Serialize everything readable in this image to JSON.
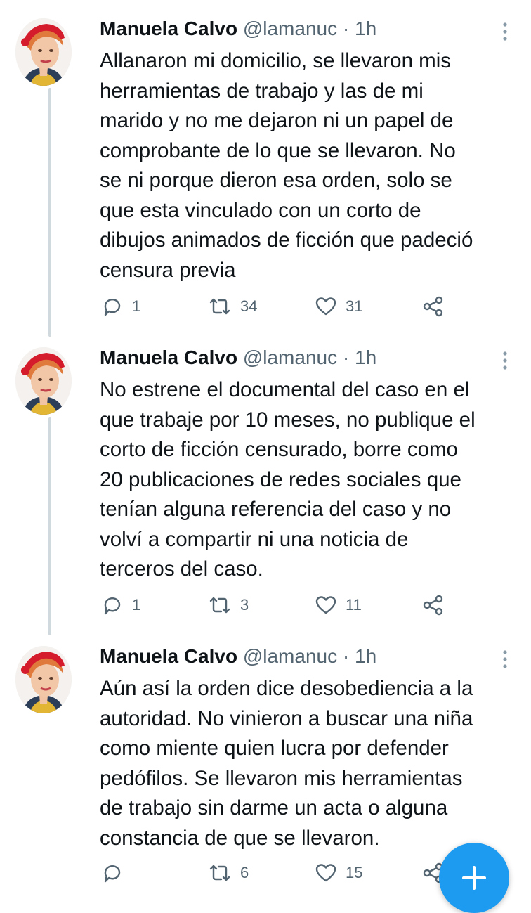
{
  "tweets": [
    {
      "name": "Manuela Calvo",
      "handle": "@lamanuc",
      "separator": "·",
      "time": "1h",
      "lines": [
        "Allanaron mi domicilio, se llevaron mis",
        "herramientas de trabajo y las de mi",
        "marido y no me dejaron ni un papel de",
        "comprobante de lo que se llevaron. No",
        "se ni porque dieron esa orden, solo se",
        "que esta vinculado con un corto de",
        "dibujos animados de ficción que padeció",
        "censura previa"
      ],
      "replies": "1",
      "retweets": "34",
      "likes": "31"
    },
    {
      "name": "Manuela Calvo",
      "handle": "@lamanuc",
      "separator": "·",
      "time": "1h",
      "lines": [
        "No estrene el documental del caso en el",
        "que trabaje por 10 meses, no publique el",
        "corto de ficción censurado, borre como",
        "20 publicaciones de redes sociales que",
        "tenían alguna referencia del caso y no",
        "volví a compartir ni una noticia de",
        "terceros del caso."
      ],
      "replies": "1",
      "retweets": "3",
      "likes": "11"
    },
    {
      "name": "Manuela Calvo",
      "handle": "@lamanuc",
      "separator": "·",
      "time": "1h",
      "lines": [
        "Aún así la orden dice desobediencia a la",
        "autoridad. No vinieron a buscar una niña",
        "como miente quien lucra por defender",
        "pedófilos. Se llevaron mis herramientas",
        "de trabajo sin darme un acta o alguna",
        "constancia de que se llevaron."
      ],
      "replies": "",
      "retweets": "6",
      "likes": "15"
    }
  ],
  "colors": {
    "text": "#0f1419",
    "secondary": "#536471",
    "thread_line": "#cfd9de",
    "accent": "#1d9bf0"
  },
  "icons": {
    "more": "more-vertical-icon",
    "reply": "reply-icon",
    "retweet": "retweet-icon",
    "like": "heart-icon",
    "share": "share-icon",
    "compose": "plus-icon"
  }
}
